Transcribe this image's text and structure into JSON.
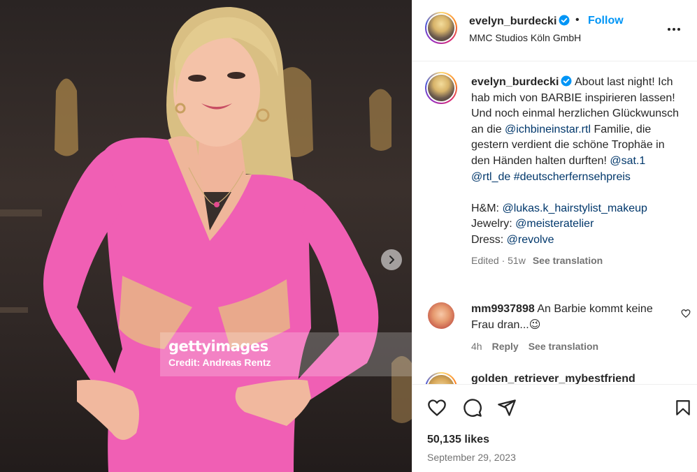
{
  "post": {
    "username": "evelyn_burdecki",
    "follow_label": "Follow",
    "separator": "•",
    "location": "MMC Studios Köln GmbH",
    "caption": {
      "username": "evelyn_burdecki",
      "text_1": "About last night! Ich hab mich von BARBIE inspirieren lassen! Und noch einmal herzlichen Glückwunsch an die ",
      "mention_1": "@ichbineinstar.rtl",
      "text_2": " Familie, die gestern verdient die schöne Trophäe in den Händen halten durften! ",
      "mention_2": "@sat.1",
      "mention_3": "@rtl_de",
      "hashtag": "#deutscherfernsehpreis",
      "hm_label": "H&M: ",
      "hm_mention": "@lukas.k_hairstylist_makeup",
      "jewelry_label": "Jewelry: ",
      "jewelry_mention": "@meisteratelier",
      "dress_label": "Dress: ",
      "dress_mention": "@revolve",
      "edited": "Edited · 51w",
      "see_translation": "See translation"
    },
    "comments": [
      {
        "username": "mm9937898",
        "text": "An Barbie kommt keine Frau dran...",
        "emoji": "😉",
        "age": "4h",
        "reply": "Reply",
        "see_translation": "See translation"
      },
      {
        "username": "golden_retriever_mybestfriend"
      }
    ],
    "likes": "50,135 likes",
    "date": "September 29, 2023"
  },
  "media": {
    "watermark_logo": "gettyimages",
    "watermark_credit": "Credit: Andreas Rentz"
  },
  "icons": {
    "verified": "verified-badge-icon",
    "more": "more-options-icon",
    "next": "chevron-right-icon",
    "like": "heart-icon",
    "comment": "comment-icon",
    "share": "share-icon",
    "save": "bookmark-icon"
  },
  "colors": {
    "accent": "#0095f6",
    "link": "#00376b",
    "dress": "#f05fb4",
    "muted": "#737373"
  }
}
